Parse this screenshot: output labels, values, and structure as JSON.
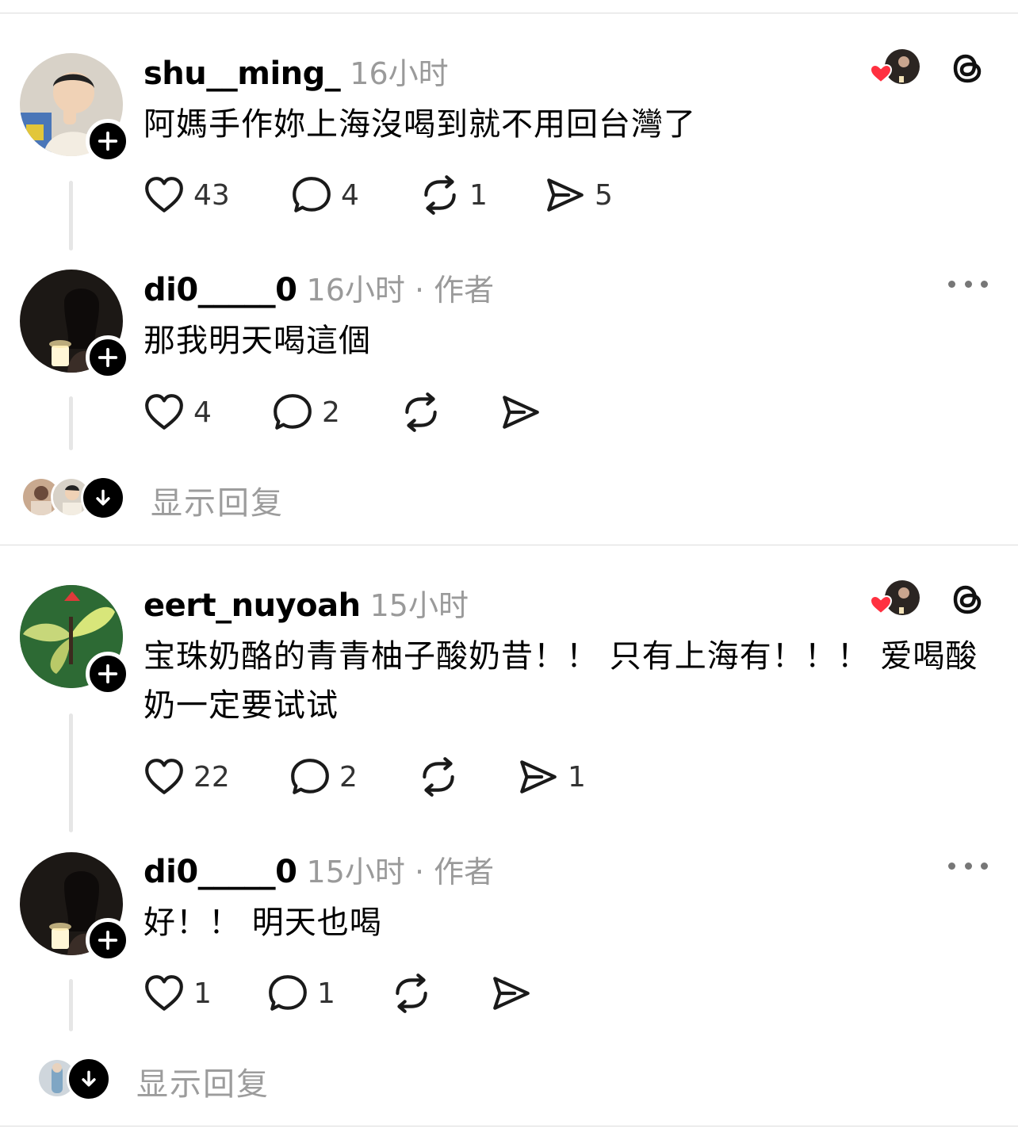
{
  "posts": [
    {
      "username": "shu__ming_",
      "time": "16小时",
      "text": "阿媽手作妳上海沒喝到就不用回台灣了",
      "likes": "43",
      "comments": "4",
      "reposts": "1",
      "shares": "5"
    },
    {
      "username": "di0_____0",
      "time": "16小时 · 作者",
      "text": "那我明天喝這個",
      "likes": "4",
      "comments": "2",
      "reposts": "",
      "shares": ""
    },
    {
      "username": "eert_nuyoah",
      "time": "15小时",
      "text": "宝珠奶酪的青青柚子酸奶昔！！ 只有上海有！！！ 爱喝酸奶一定要试试",
      "likes": "22",
      "comments": "2",
      "reposts": "",
      "shares": "1"
    },
    {
      "username": "di0_____0",
      "time": "15小时 · 作者",
      "text": "好！！ 明天也喝",
      "likes": "1",
      "comments": "1",
      "reposts": "",
      "shares": ""
    }
  ],
  "show_replies_label": "显示回复",
  "colors": {
    "heart": "#ff3040",
    "text": "#000000",
    "muted": "#9a9a9a"
  },
  "icons": [
    "heart-icon",
    "comment-icon",
    "repost-icon",
    "share-icon",
    "threads-logo-icon",
    "more-icon",
    "plus-icon",
    "arrow-down-icon"
  ]
}
